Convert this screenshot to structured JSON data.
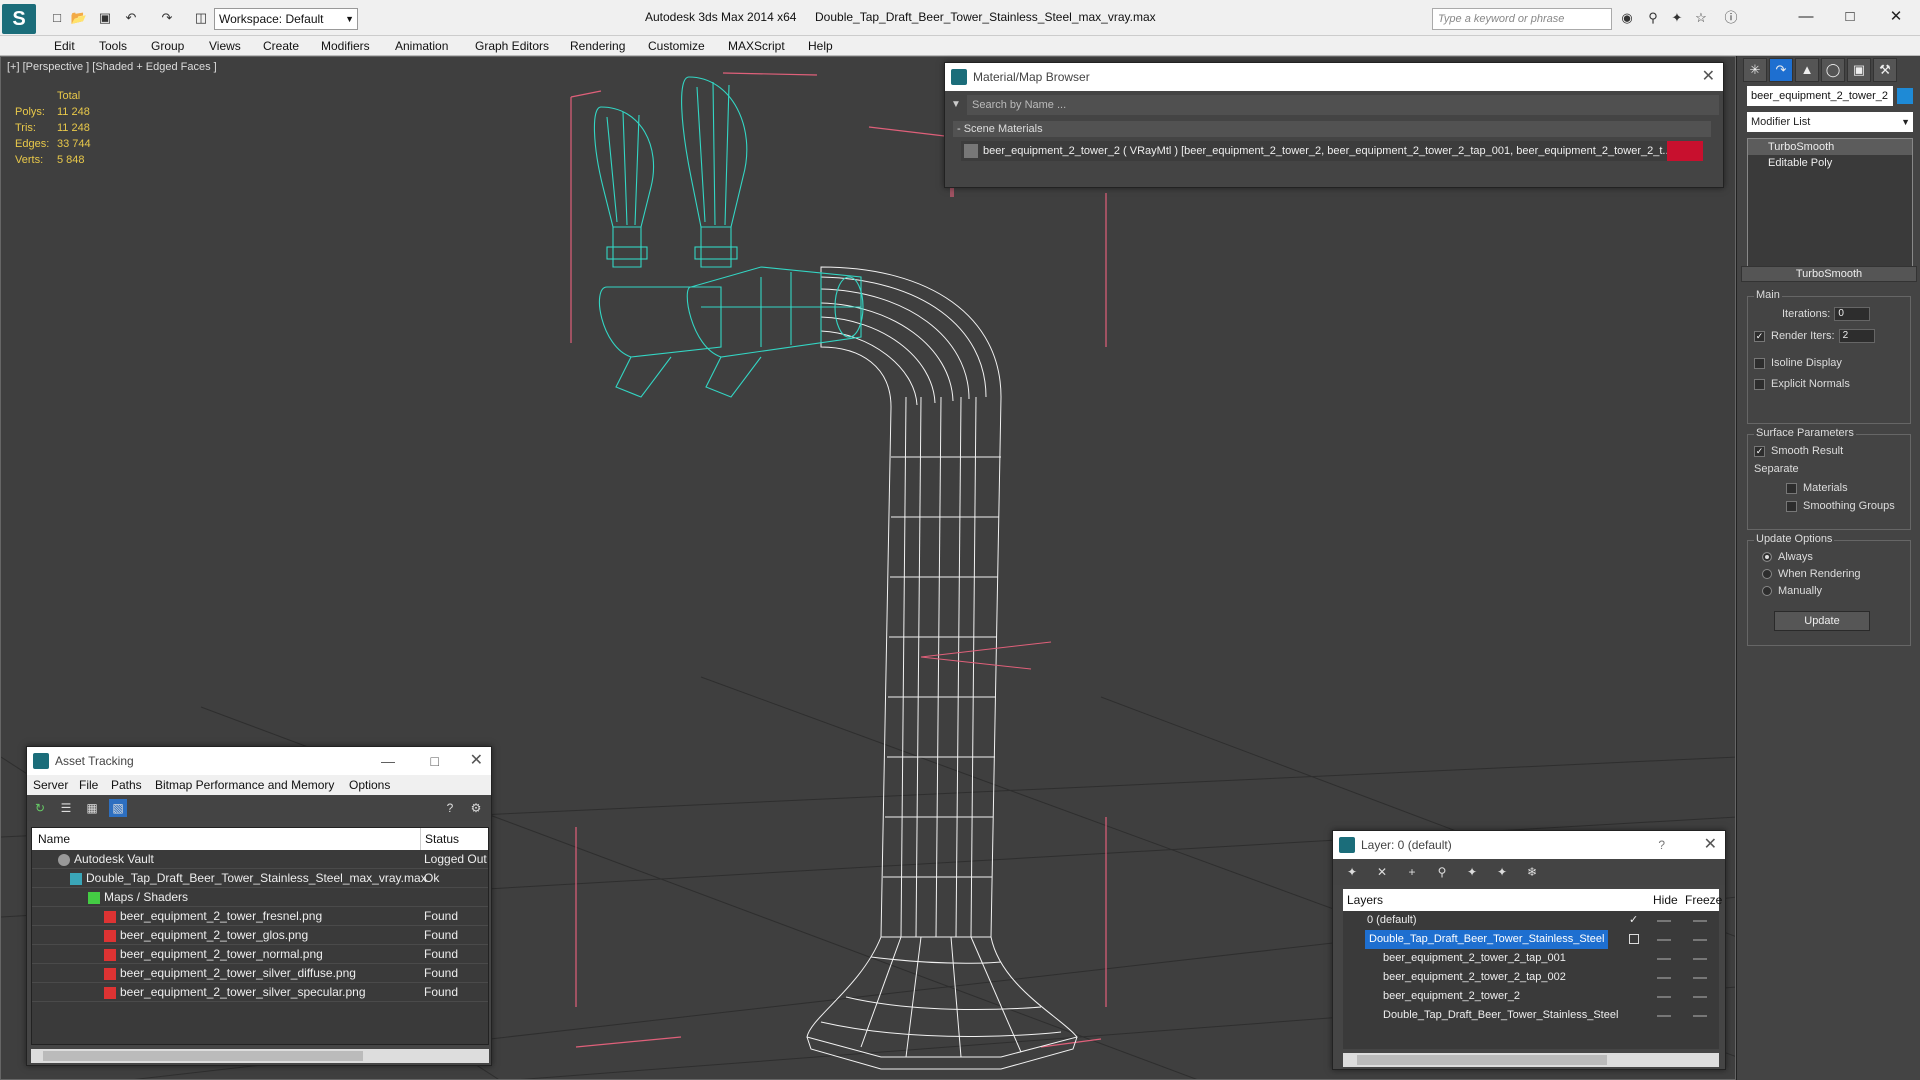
{
  "titlebar": {
    "workspace": "Workspace: Default",
    "app_title": "Autodesk 3ds Max  2014 x64",
    "file_title": "Double_Tap_Draft_Beer_Tower_Stainless_Steel_max_vray.max",
    "search_placeholder": "Type a keyword or phrase"
  },
  "menu": [
    "Edit",
    "Tools",
    "Group",
    "Views",
    "Create",
    "Modifiers",
    "Animation",
    "Graph Editors",
    "Rendering",
    "Customize",
    "MAXScript",
    "Help"
  ],
  "viewport": {
    "label": "[+] [Perspective ] [Shaded + Edged Faces ]",
    "stats": {
      "total_label": "Total",
      "polys_label": "Polys:",
      "polys": "11 248",
      "tris_label": "Tris:",
      "tris": "11 248",
      "edges_label": "Edges:",
      "edges": "33 744",
      "verts_label": "Verts:",
      "verts": "5 848"
    },
    "wire_color": "#ffffff",
    "selected_wire_color": "#33d6c4",
    "bbox_color": "#e0607a"
  },
  "material_browser": {
    "title": "Material/Map Browser",
    "search_placeholder": "Search by Name ...",
    "section": "- Scene Materials",
    "row": "beer_equipment_2_tower_2  ( VRayMtl )  [beer_equipment_2_tower_2, beer_equipment_2_tower_2_tap_001, beer_equipment_2_tower_2_t..."
  },
  "command_panel": {
    "object_name": "beer_equipment_2_tower_2",
    "object_color": "#1e8ad6",
    "modifier_list": "Modifier List",
    "stack": [
      "TurboSmooth",
      "Editable Poly"
    ],
    "rollout_title": "TurboSmooth",
    "main_label": "Main",
    "iterations_label": "Iterations:",
    "iterations": "0",
    "render_iters_label": "Render Iters:",
    "render_iters": "2",
    "render_iters_checked": true,
    "isoline": "Isoline Display",
    "isoline_checked": false,
    "explicit": "Explicit Normals",
    "explicit_checked": false,
    "surface_label": "Surface Parameters",
    "smooth_result": "Smooth Result",
    "smooth_result_checked": true,
    "separate_label": "Separate",
    "materials": "Materials",
    "materials_checked": false,
    "smoothing_groups": "Smoothing Groups",
    "smoothing_groups_checked": false,
    "update_label": "Update Options",
    "always": "Always",
    "when_rendering": "When Rendering",
    "manually": "Manually",
    "update_selected": "Always",
    "update_button": "Update"
  },
  "asset_tracking": {
    "title": "Asset Tracking",
    "menu": [
      "Server",
      "File",
      "Paths",
      "Bitmap Performance and Memory",
      "Options"
    ],
    "col_name": "Name",
    "col_status": "Status",
    "rows": [
      {
        "name": "Autodesk Vault",
        "status": "Logged Out",
        "indent": 1,
        "icon": "vault"
      },
      {
        "name": "Double_Tap_Draft_Beer_Tower_Stainless_Steel_max_vray.max",
        "status": "Ok",
        "indent": 2,
        "icon": "max"
      },
      {
        "name": "Maps / Shaders",
        "status": "",
        "indent": 3,
        "icon": "maps"
      },
      {
        "name": "beer_equipment_2_tower_fresnel.png",
        "status": "Found",
        "indent": 4,
        "icon": "png"
      },
      {
        "name": "beer_equipment_2_tower_glos.png",
        "status": "Found",
        "indent": 4,
        "icon": "png"
      },
      {
        "name": "beer_equipment_2_tower_normal.png",
        "status": "Found",
        "indent": 4,
        "icon": "png"
      },
      {
        "name": "beer_equipment_2_tower_silver_diffuse.png",
        "status": "Found",
        "indent": 4,
        "icon": "png"
      },
      {
        "name": "beer_equipment_2_tower_silver_specular.png",
        "status": "Found",
        "indent": 4,
        "icon": "png"
      }
    ]
  },
  "layer_panel": {
    "title": "Layer: 0 (default)",
    "col_layers": "Layers",
    "col_hide": "Hide",
    "col_freeze": "Freeze",
    "rows": [
      {
        "name": "0 (default)",
        "indent": 1,
        "selected": false
      },
      {
        "name": "Double_Tap_Draft_Beer_Tower_Stainless_Steel",
        "indent": 1,
        "selected": true
      },
      {
        "name": "beer_equipment_2_tower_2_tap_001",
        "indent": 2,
        "selected": false
      },
      {
        "name": "beer_equipment_2_tower_2_tap_002",
        "indent": 2,
        "selected": false
      },
      {
        "name": "beer_equipment_2_tower_2",
        "indent": 2,
        "selected": false
      },
      {
        "name": "Double_Tap_Draft_Beer_Tower_Stainless_Steel",
        "indent": 2,
        "selected": false
      }
    ]
  }
}
